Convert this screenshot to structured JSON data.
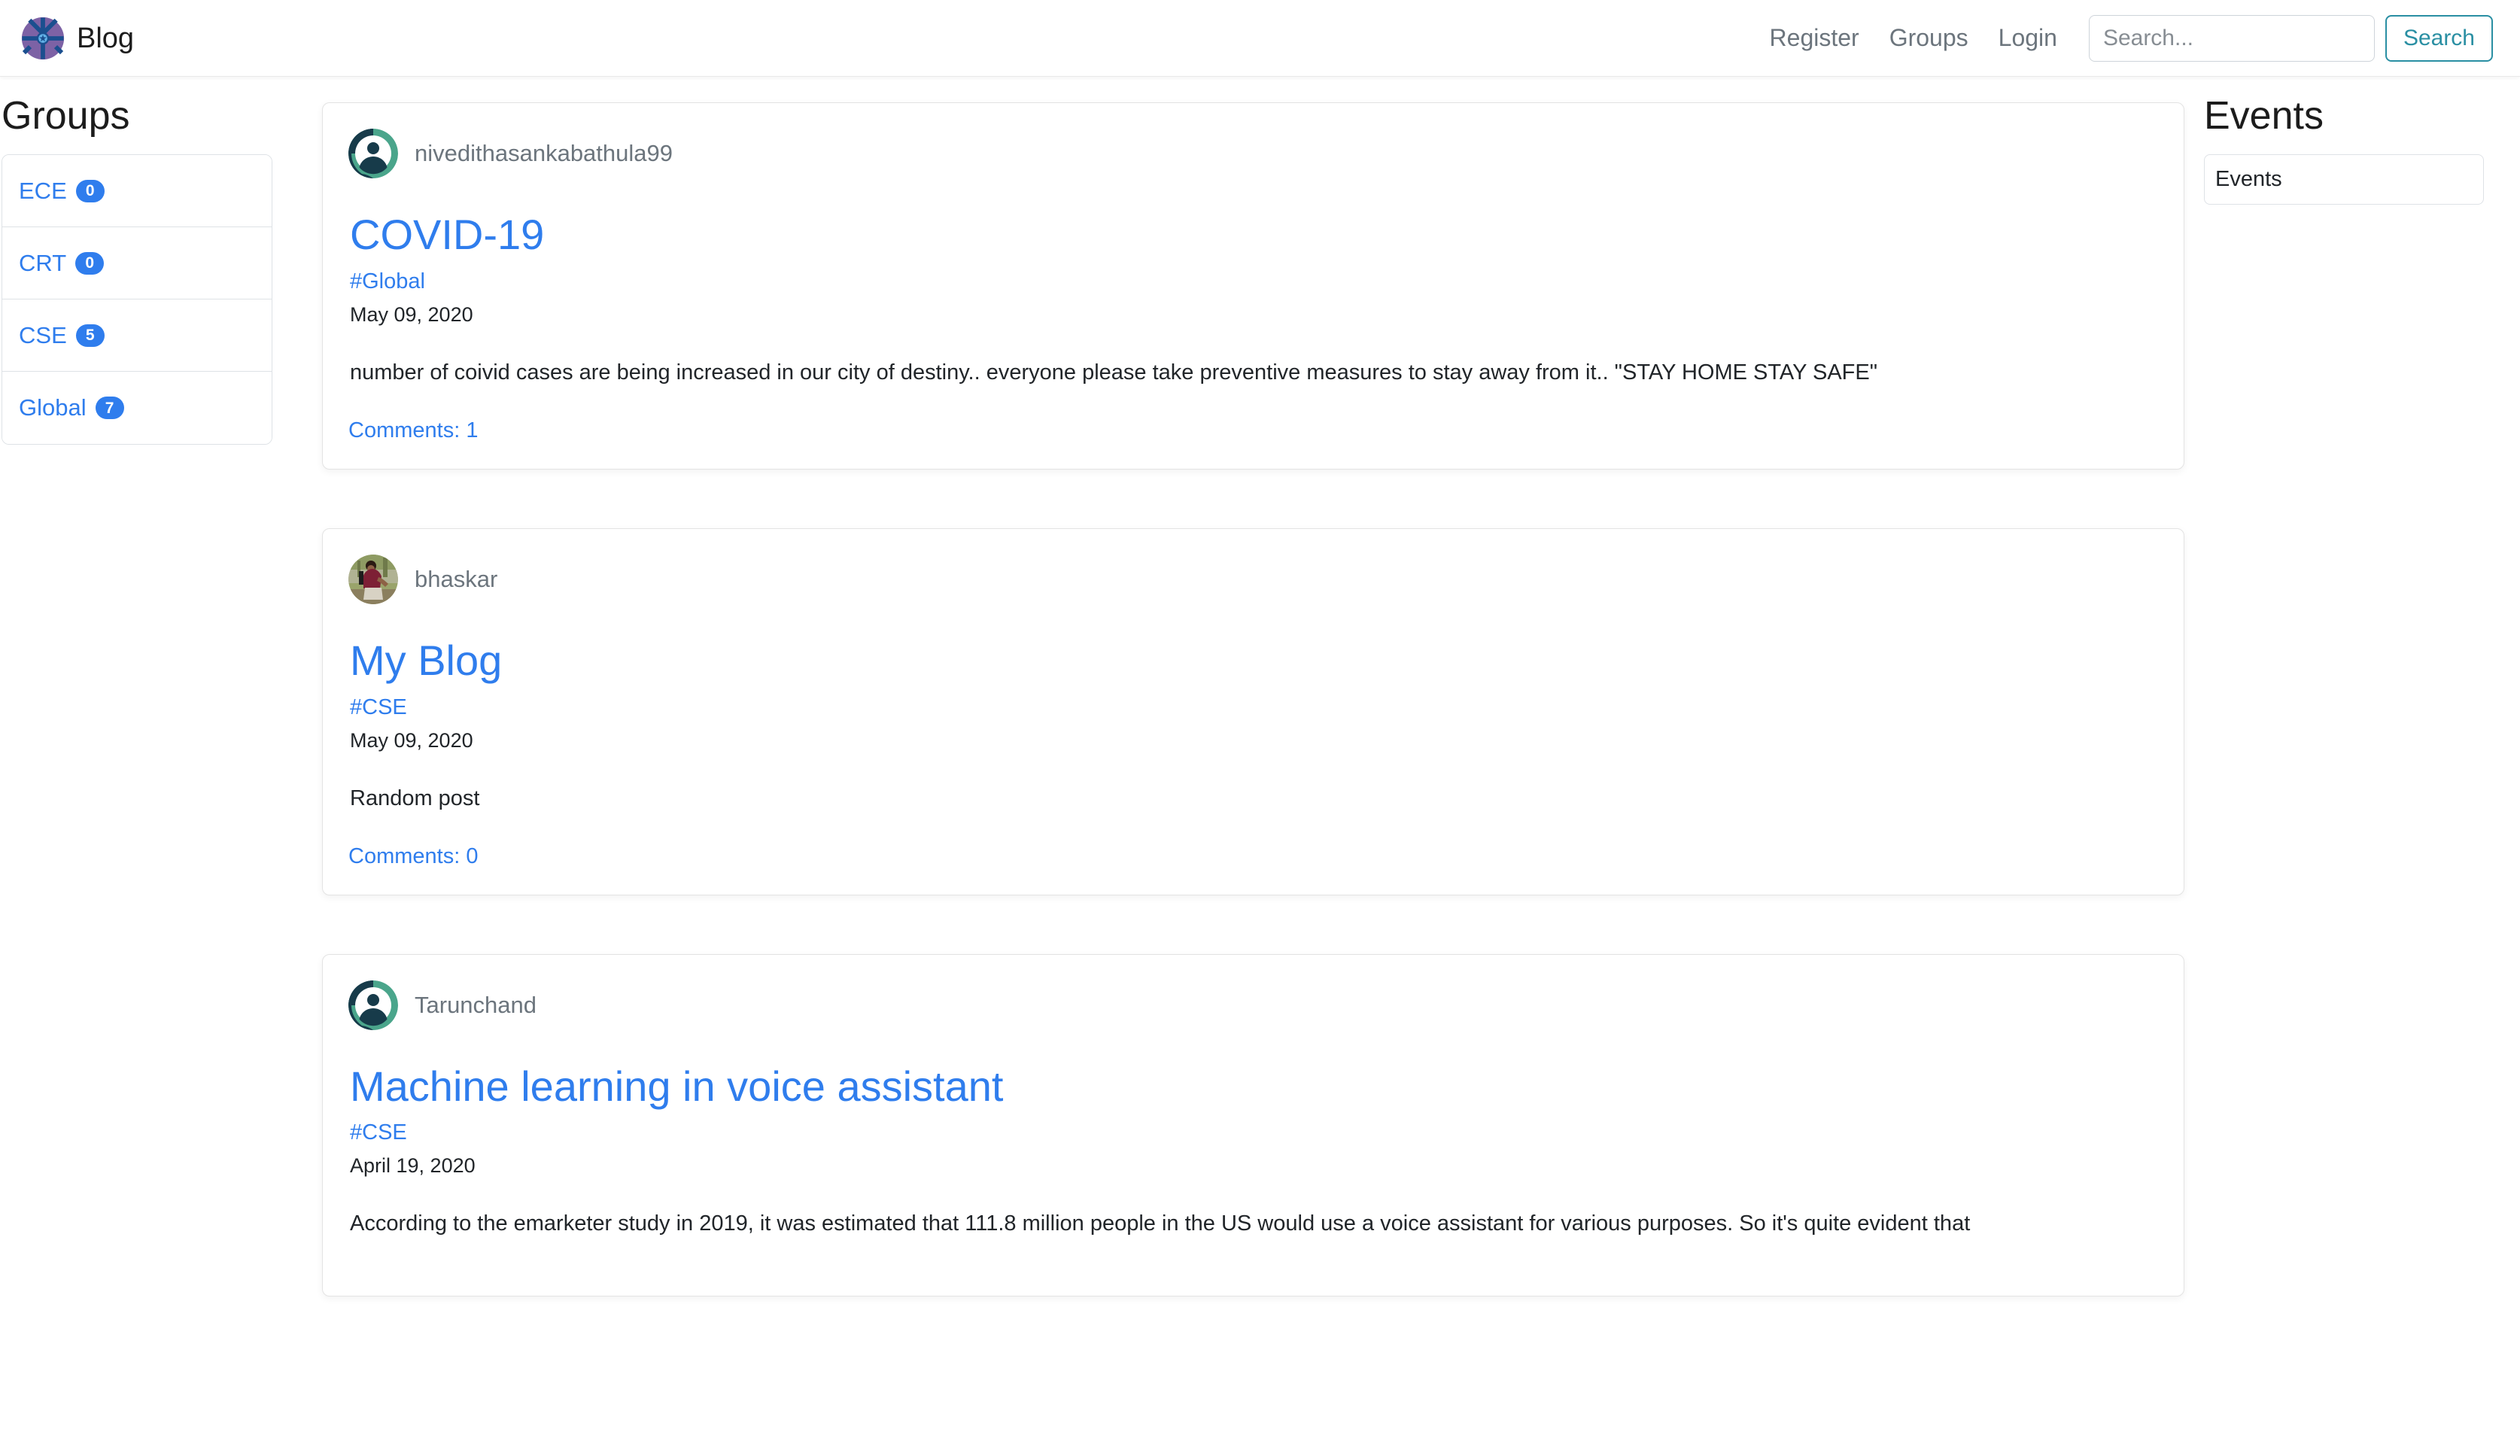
{
  "navbar": {
    "brand": "Blog",
    "logo_icon": "blog-wheel-logo-icon",
    "links": [
      {
        "label": "Register",
        "name": "register"
      },
      {
        "label": "Groups",
        "name": "groups"
      },
      {
        "label": "Login",
        "name": "login"
      }
    ],
    "search": {
      "placeholder": "Search...",
      "value": "",
      "button_label": "Search",
      "button_color": "#2a8fa3"
    }
  },
  "sidebar": {
    "title": "Groups",
    "items": [
      {
        "label": "ECE",
        "count": "0"
      },
      {
        "label": "CRT",
        "count": "0"
      },
      {
        "label": "CSE",
        "count": "5"
      },
      {
        "label": "Global",
        "count": "7"
      }
    ],
    "badge_color": "#2f7ded",
    "link_color": "#2f7ded"
  },
  "events": {
    "title": "Events",
    "items": [
      {
        "label": "Events"
      }
    ]
  },
  "posts": [
    {
      "author": "nivedithasankabathula99",
      "avatar_type": "default-person-avatar",
      "title": "COVID-19",
      "tag": "#Global",
      "date": "May 09, 2020",
      "body": "number of coivid cases are being increased in our city of destiny.. everyone please take preventive measures to stay away from it.. \"STAY HOME STAY SAFE\"",
      "comments": "Comments: 1"
    },
    {
      "author": "bhaskar",
      "avatar_type": "photo-avatar",
      "title": "My Blog",
      "tag": "#CSE",
      "date": "May 09, 2020",
      "body": "Random post",
      "comments": "Comments: 0"
    },
    {
      "author": "Tarunchand",
      "avatar_type": "default-person-avatar",
      "title": "Machine learning in voice assistant",
      "tag": "#CSE",
      "date": "April 19, 2020",
      "body": "According to the emarketer study in 2019, it was estimated that 111.8 million people in the US would use a voice assistant for various purposes. So it's quite evident that",
      "comments": ""
    }
  ]
}
